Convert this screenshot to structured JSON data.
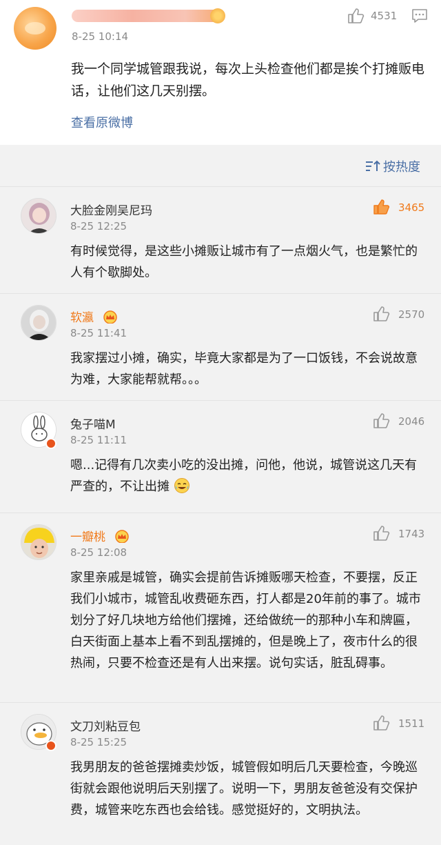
{
  "original_post": {
    "time": "8-25 10:14",
    "like_count": "4531",
    "text": "我一个同学城管跟我说，每次上头检查他们都是挨个打摊贩电话，让他们这几天别摆。",
    "view_original": "查看原微博",
    "icons": {
      "like": "thumbs-up-icon",
      "comment": "comment-icon"
    }
  },
  "sort": {
    "label": "按热度",
    "icon": "sort-icon"
  },
  "comments": [
    {
      "name": "大脸金刚吴尼玛",
      "time": "8-25 12:25",
      "likes": "3465",
      "liked": true,
      "text": "有时候觉得，是这些小摊贩让城市有了一点烟火气，也是繁忙的人有个歇脚处。"
    },
    {
      "name": "软瀛",
      "time": "8-25 11:41",
      "likes": "2570",
      "vip": true,
      "text": "我家摆过小摊，确实，毕竟大家都是为了一口饭钱，不会说故意为难，大家能帮就帮。。。"
    },
    {
      "name": "兔子喵M",
      "time": "8-25 11:11",
      "likes": "2046",
      "text": "嗯...记得有几次卖小吃的没出摊，问他，他说，城管说这几天有严查的，不让出摊"
    },
    {
      "name": "一瓣桃",
      "time": "8-25 12:08",
      "likes": "1743",
      "vip": true,
      "text": "家里亲戚是城管，确实会提前告诉摊贩哪天检查，不要摆，反正我们小城市，城管乱收费砸东西，打人都是20年前的事了。城市划分了好几块地方给他们摆摊，还给做统一的那种小车和牌匾，白天街面上基本上看不到乱摆摊的，但是晚上了，夜市什么的很热闹，只要不检查还是有人出来摆。说句实话，脏乱碍事。"
    },
    {
      "name": "文刀刘粘豆包",
      "time": "8-25 15:25",
      "likes": "1511",
      "text": "我男朋友的爸爸摆摊卖炒饭，城管假如明后几天要检查，今晚巡街就会跟他说明后天别摆了。说明一下，男朋友爸爸没有交保护费，城管来吃东西也会给钱。感觉挺好的，文明执法。"
    }
  ],
  "colors": {
    "accent_orange": "#f07a1b",
    "link_blue": "#4a6fa5",
    "muted": "#8a8a8a"
  }
}
